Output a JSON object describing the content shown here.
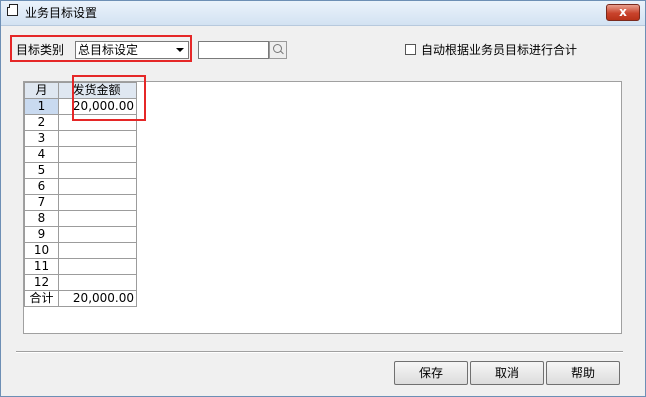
{
  "window": {
    "title": "业务目标设置",
    "close_label": "x"
  },
  "filter": {
    "category_label": "目标类别",
    "category_value": "总目标设定",
    "search_value": "",
    "auto_sum_label": "自动根据业务员目标进行合计",
    "auto_sum_checked": false
  },
  "grid": {
    "columns": [
      "月",
      "发货金额"
    ],
    "rows": [
      [
        "1",
        "20,000.00"
      ],
      [
        "2",
        ""
      ],
      [
        "3",
        ""
      ],
      [
        "4",
        ""
      ],
      [
        "5",
        ""
      ],
      [
        "6",
        ""
      ],
      [
        "7",
        ""
      ],
      [
        "8",
        ""
      ],
      [
        "9",
        ""
      ],
      [
        "10",
        ""
      ],
      [
        "11",
        ""
      ],
      [
        "12",
        ""
      ]
    ],
    "total_label": "合计",
    "total_value": "20,000.00"
  },
  "buttons": {
    "save": "保存",
    "cancel": "取消",
    "help": "帮助"
  },
  "colors": {
    "highlight": "#e52727",
    "close": "#c9432c"
  }
}
